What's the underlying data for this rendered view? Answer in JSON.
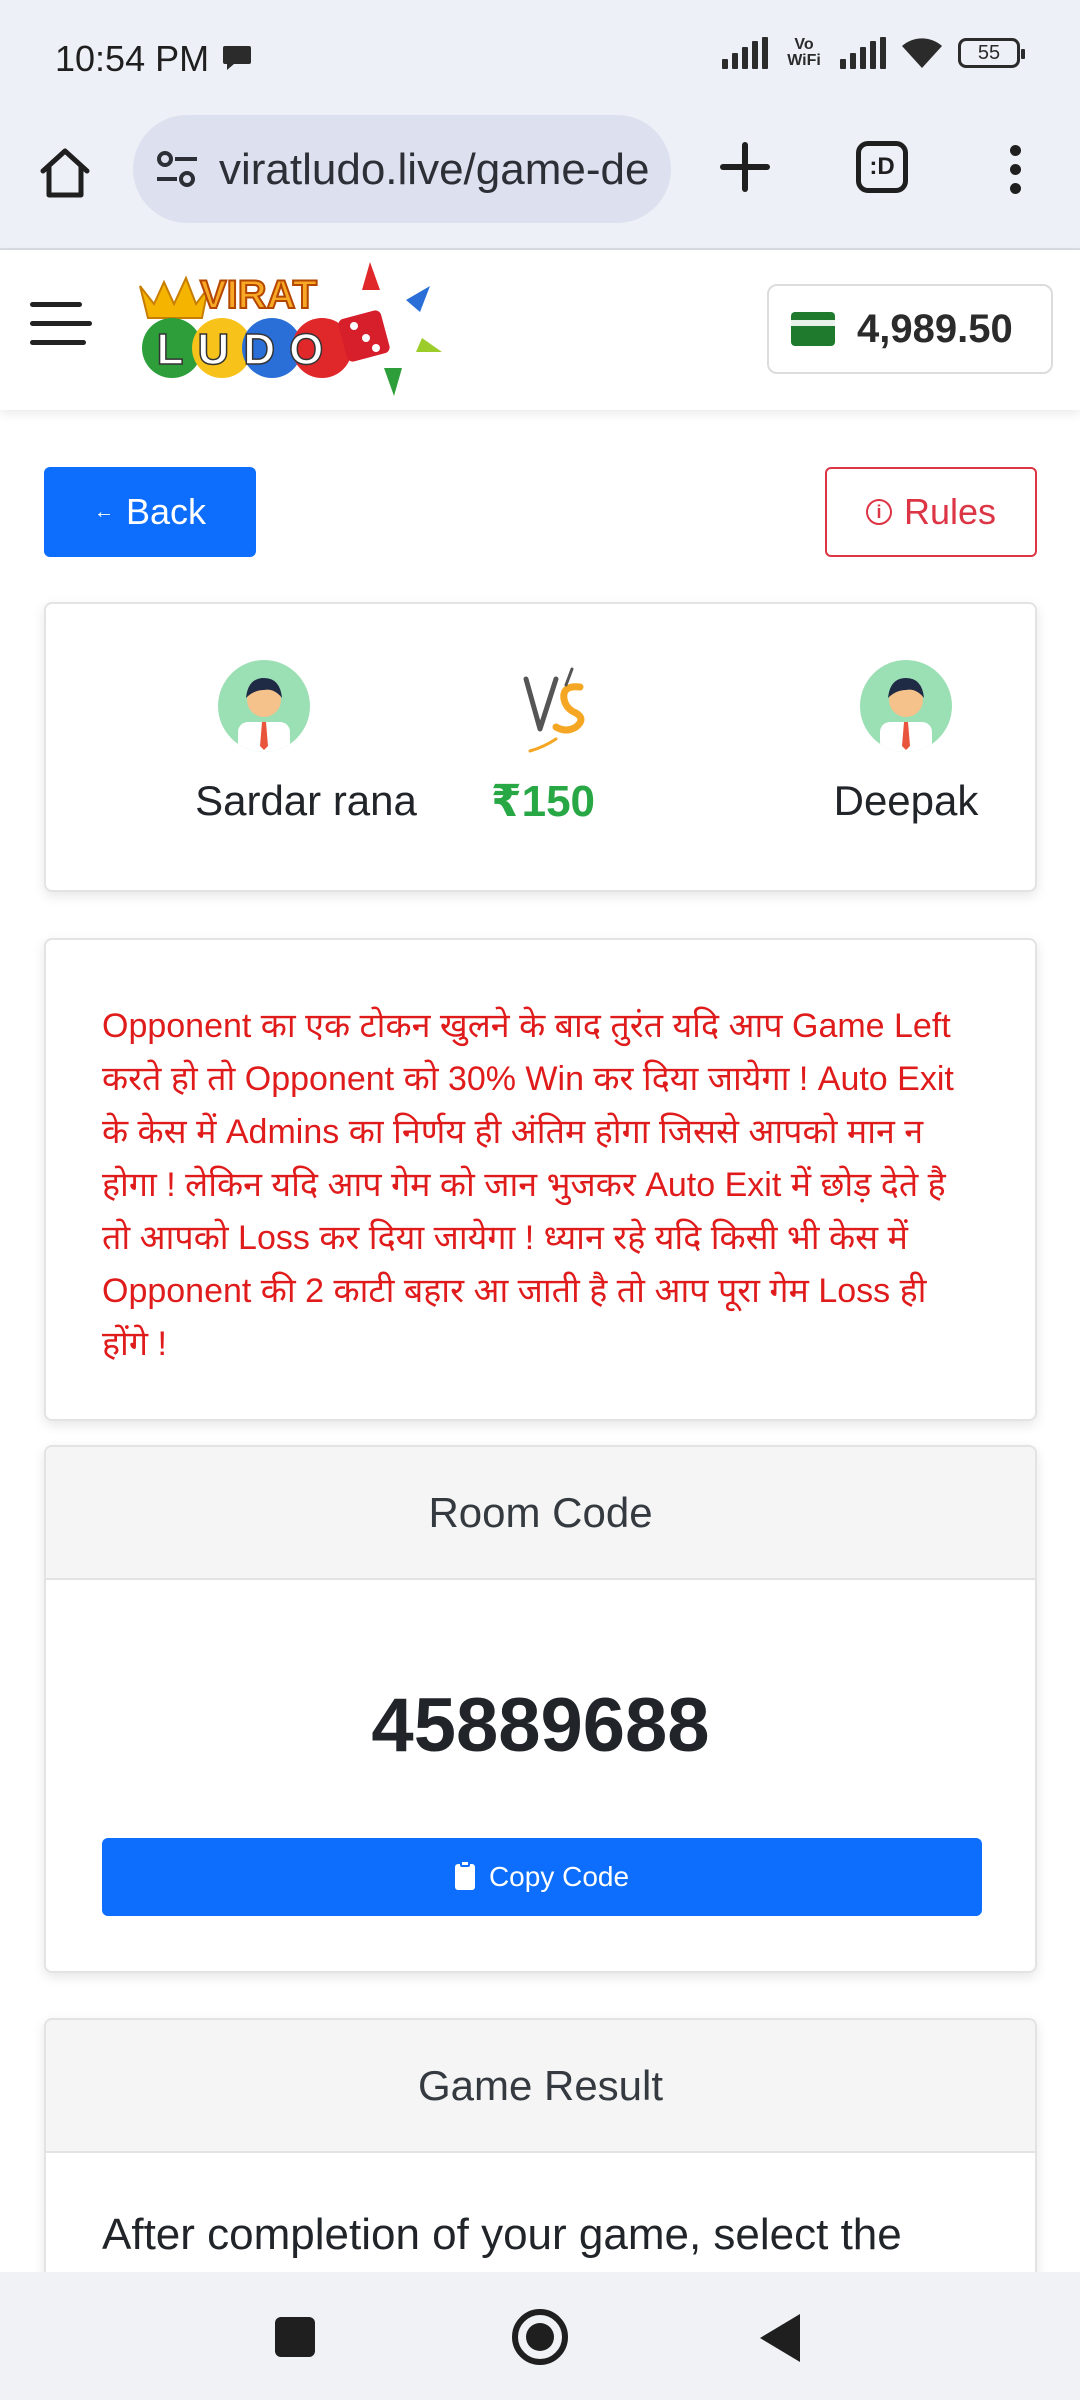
{
  "status_bar": {
    "time": "10:54 PM",
    "network": "Vo WiFi",
    "battery": "55"
  },
  "browser": {
    "url": "viratludo.live/game-de",
    "tab_label": ":D"
  },
  "header": {
    "logo_top": "VIRAT",
    "logo_bottom": "LUDO",
    "wallet_balance": "4,989.50",
    "brand_color": "#1f7a2e"
  },
  "actions": {
    "back_label": "Back",
    "rules_label": "Rules"
  },
  "match": {
    "player1": "Sardar rana",
    "player2": "Deepak",
    "amount": "₹150",
    "vs_label": "VS"
  },
  "notice": {
    "text": "Opponent का एक टोकन खुलने के बाद तुरंत यदि आप Game Left करते हो तो Opponent को 30% Win कर दिया जायेगा ! Auto Exit के केस में Admins का निर्णय ही अंतिम होगा जिससे आपको मान न होगा ! लेकिन यदि आप गेम को जान भुजकर Auto Exit में छोड़ देते है तो आपको Loss कर दिया जायेगा ! ध्यान रहे यदि किसी भी केस में Opponent की 2 काटी बहार आ जाती है तो आप पूरा गेम Loss ही होंगे !"
  },
  "room": {
    "title": "Room Code",
    "code": "45889688",
    "copy_label": "Copy Code"
  },
  "result": {
    "title": "Game Result",
    "text": "After completion of your game, select the"
  },
  "colors": {
    "primary": "#0d6efd",
    "danger": "#dc3545",
    "success": "#28a745",
    "notice": "#e01b1b"
  }
}
